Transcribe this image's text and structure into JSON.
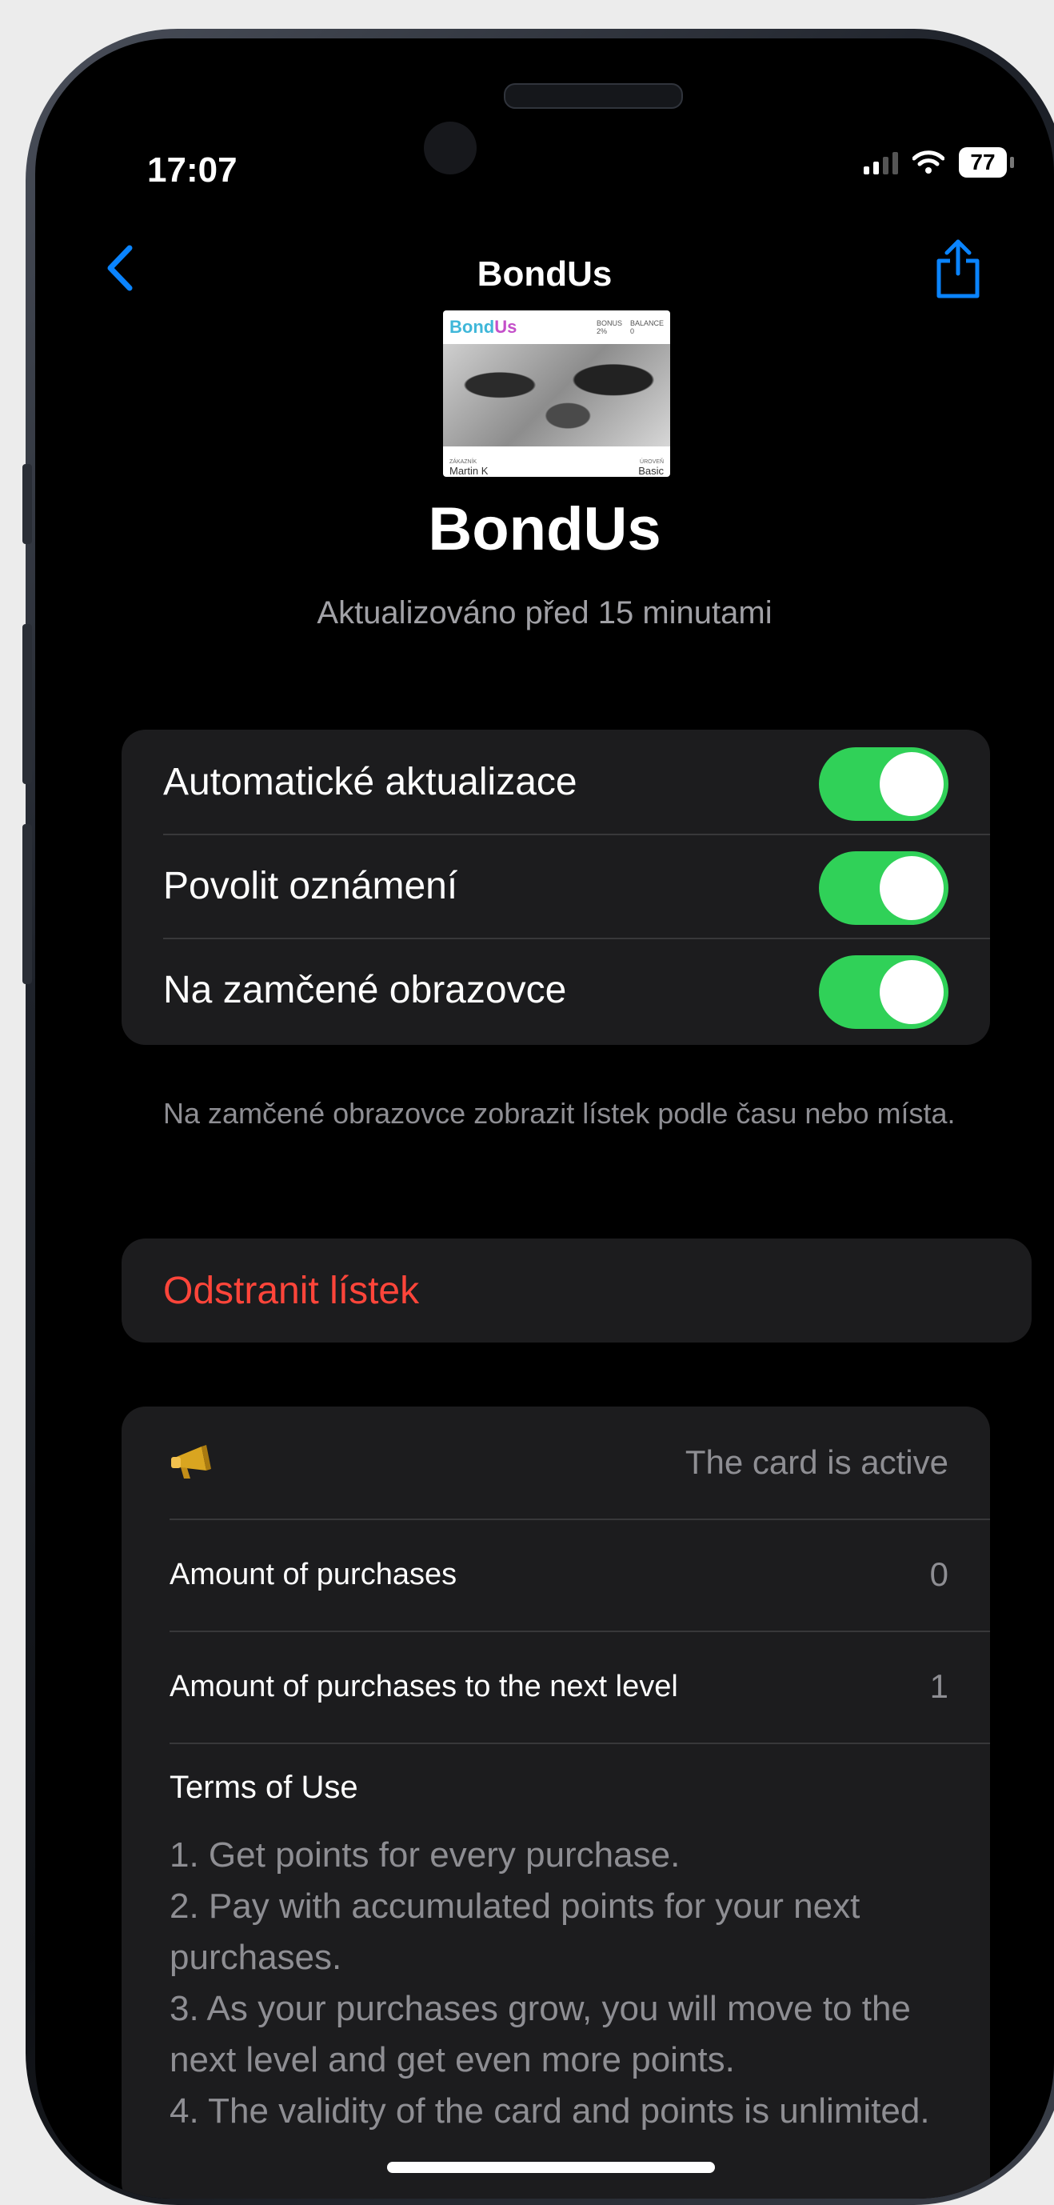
{
  "status_bar": {
    "time": "17:07",
    "battery": "77"
  },
  "nav": {
    "title": "BondUs",
    "back_icon": "chevron-left-icon",
    "share_icon": "share-icon"
  },
  "pass": {
    "logo_prefix": "Bond",
    "logo_suffix": "Us",
    "bonus_label": "BONUS",
    "bonus_value": "2%",
    "balance_label": "BALANCE",
    "balance_value": "0",
    "customer_label": "ZÁKAZNÍK",
    "customer_name": "Martin K",
    "level_label": "ÚROVEŇ",
    "level_value": "Basic"
  },
  "header": {
    "title": "BondUs",
    "updated": "Aktualizováno před 15 minutami"
  },
  "settings": {
    "toggles": [
      {
        "label": "Automatické aktualizace",
        "on": true
      },
      {
        "label": "Povolit oznámení",
        "on": true
      },
      {
        "label": "Na zamčené obrazovce",
        "on": true
      }
    ],
    "footnote": "Na zamčené obrazovce zobrazit lístek podle času nebo místa.",
    "delete_label": "Odstranit lístek"
  },
  "details": {
    "status_icon": "megaphone-icon",
    "status_text": "The card is active",
    "rows": [
      {
        "label": "Amount of purchases",
        "value": "0"
      },
      {
        "label": "Amount of purchases to the next level",
        "value": "1"
      }
    ],
    "terms_title": "Terms of Use",
    "terms_lines": [
      "1. Get points for every purchase.",
      "2. Pay with accumulated points for your next purchases.",
      "3. As your purchases grow, you will move to the next level and get even more points.",
      "4. The validity of the card and points is unlimited."
    ]
  },
  "colors": {
    "accent_blue": "#0a84ff",
    "toggle_green": "#30d158",
    "destructive_red": "#ff453a"
  }
}
